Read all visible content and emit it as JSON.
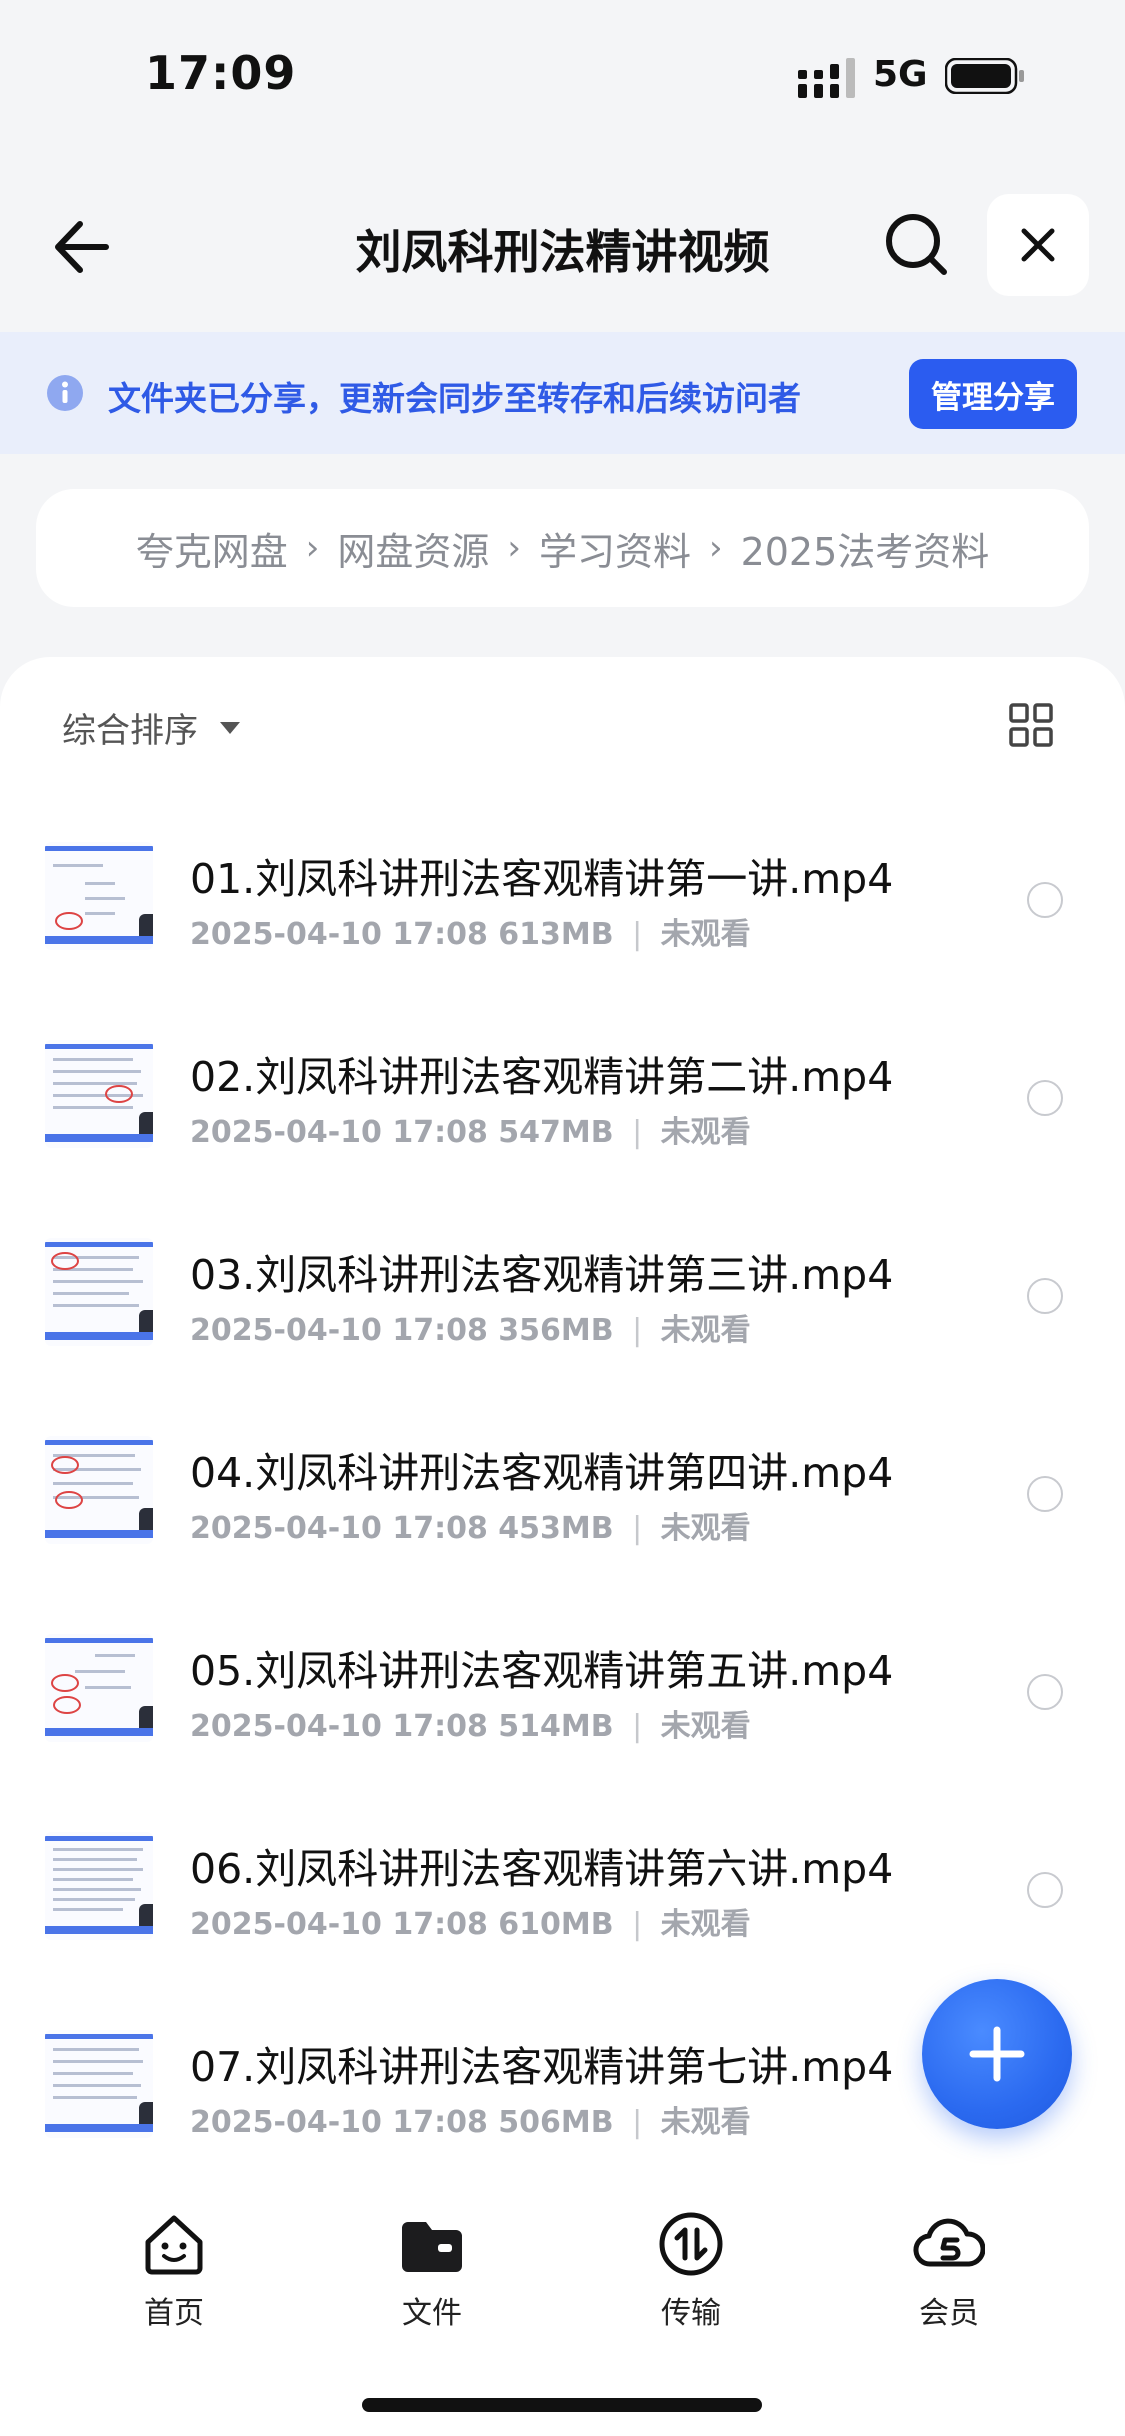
{
  "status_bar": {
    "time": "17:09",
    "network": "5G"
  },
  "nav": {
    "title": "刘凤科刑法精讲视频",
    "icons": {
      "back": "back-arrow-icon",
      "search": "search-icon",
      "close": "close-icon"
    }
  },
  "banner": {
    "text": "文件夹已分享，更新会同步至转存和后续访问者",
    "button": "管理分享",
    "icon": "info-icon"
  },
  "breadcrumb": {
    "items": [
      "夸克网盘",
      "网盘资源",
      "学习资料",
      "2025法考资料"
    ],
    "separator": "›"
  },
  "sort": {
    "label": "综合排序",
    "view_icon": "grid-view-icon"
  },
  "files": [
    {
      "name": "01.刘凤科讲刑法客观精讲第一讲.mp4",
      "date": "2025-04-10 17:08",
      "size": "613MB",
      "status": "未观看"
    },
    {
      "name": "02.刘凤科讲刑法客观精讲第二讲.mp4",
      "date": "2025-04-10 17:08",
      "size": "547MB",
      "status": "未观看"
    },
    {
      "name": "03.刘凤科讲刑法客观精讲第三讲.mp4",
      "date": "2025-04-10 17:08",
      "size": "356MB",
      "status": "未观看"
    },
    {
      "name": "04.刘凤科讲刑法客观精讲第四讲.mp4",
      "date": "2025-04-10 17:08",
      "size": "453MB",
      "status": "未观看"
    },
    {
      "name": "05.刘凤科讲刑法客观精讲第五讲.mp4",
      "date": "2025-04-10 17:08",
      "size": "514MB",
      "status": "未观看"
    },
    {
      "name": "06.刘凤科讲刑法客观精讲第六讲.mp4",
      "date": "2025-04-10 17:08",
      "size": "610MB",
      "status": "未观看"
    },
    {
      "name": "07.刘凤科讲刑法客观精讲第七讲.mp4",
      "date": "2025-04-10 17:08",
      "size": "506MB",
      "status": "未观看"
    }
  ],
  "tabs": [
    {
      "label": "首页",
      "icon": "home-smile-icon"
    },
    {
      "label": "文件",
      "icon": "folder-icon"
    },
    {
      "label": "传输",
      "icon": "transfer-icon"
    },
    {
      "label": "会员",
      "icon": "vip-cloud-icon"
    }
  ],
  "colors": {
    "accent": "#2b5cf0",
    "banner_bg": "#e9eefb",
    "page_bg": "#f4f5f7"
  }
}
